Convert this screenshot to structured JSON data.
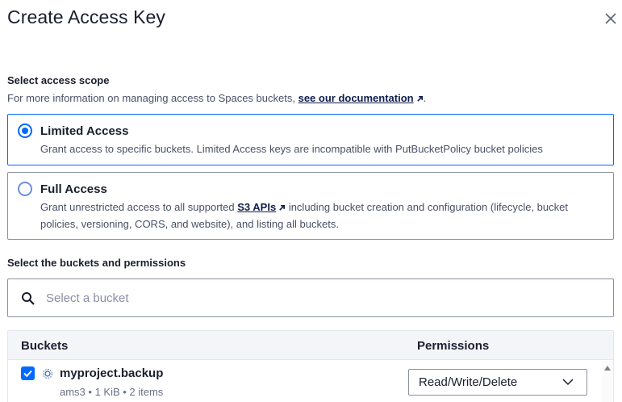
{
  "dialog": {
    "title": "Create Access Key"
  },
  "scope": {
    "label": "Select access scope",
    "help_prefix": "For more information on managing access to Spaces buckets,",
    "help_link": "see our documentation",
    "help_suffix": ".",
    "options": [
      {
        "title": "Limited Access",
        "description": "Grant access to specific buckets. Limited Access keys are incompatible with PutBucketPolicy bucket policies",
        "selected": true
      },
      {
        "title": "Full Access",
        "description_prefix": "Grant unrestricted access to all supported",
        "description_link": "S3 APIs",
        "description_suffix": "including bucket creation and configuration (lifecycle, bucket policies, versioning, CORS, and website), and listing all buckets.",
        "selected": false
      }
    ]
  },
  "buckets": {
    "label": "Select the buckets and permissions",
    "search_placeholder": "Select a bucket",
    "search_value": "",
    "table": {
      "headers": [
        "Buckets",
        "Permissions"
      ],
      "rows": [
        {
          "checked": true,
          "name": "myproject.backup",
          "meta": "ams3 • 1 KiB • 2 items",
          "permission": "Read/Write/Delete"
        }
      ]
    }
  },
  "colors": {
    "accent": "#0069ff",
    "text": "#1b1f2e",
    "muted": "#4a5066",
    "border": "#8a8fa3"
  },
  "icons": [
    "close-icon",
    "external-link-icon",
    "search-icon",
    "bucket-icon",
    "chevron-down-icon",
    "checkmark-icon",
    "scroll-up-arrow-icon"
  ]
}
